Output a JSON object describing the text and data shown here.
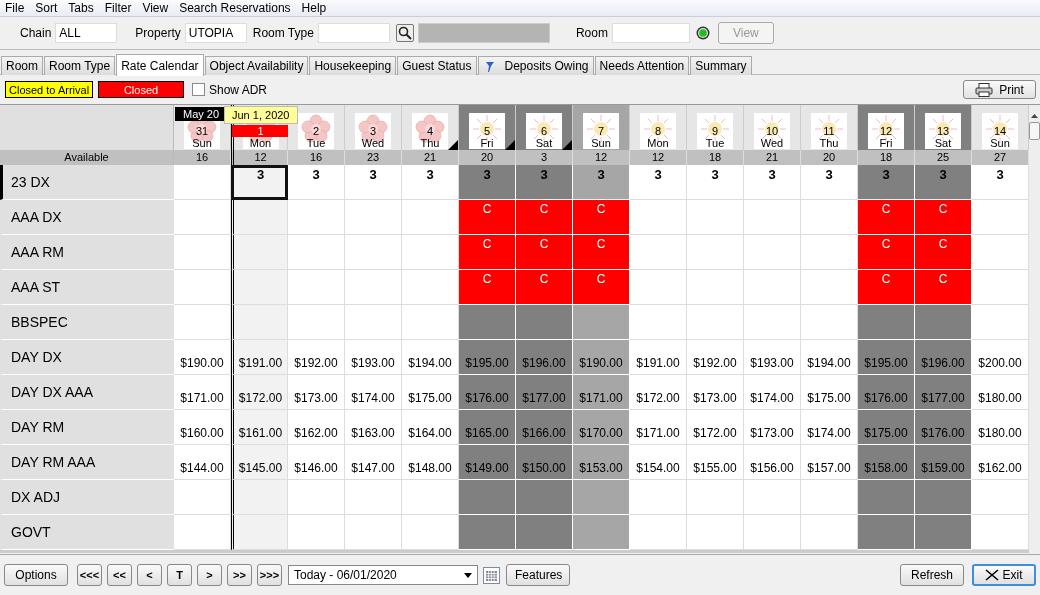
{
  "menu": [
    "File",
    "Sort",
    "Tabs",
    "Filter",
    "View",
    "Search Reservations",
    "Help"
  ],
  "toolbar": {
    "chain_label": "Chain",
    "chain": "ALL",
    "property_label": "Property",
    "property": "UTOPIA",
    "room_type_label": "Room Type",
    "room_label": "Room",
    "view_button": "View",
    "view_disabled": true
  },
  "tabs": [
    {
      "label": "Room",
      "selected": false,
      "kind": "plain"
    },
    {
      "label": "Room Type",
      "selected": false,
      "kind": "plain"
    },
    {
      "label": "Rate Calendar",
      "selected": true,
      "kind": "plain"
    },
    {
      "label": "Object Availability",
      "selected": false,
      "kind": "plain"
    },
    {
      "label": "Housekeeping",
      "selected": false,
      "kind": "plain"
    },
    {
      "label": "Guest Status",
      "selected": false,
      "kind": "plain"
    },
    {
      "label": "Deposits Owing",
      "selected": false,
      "kind": "flag"
    },
    {
      "label": "Needs Attention",
      "selected": false,
      "kind": "plain"
    },
    {
      "label": "Summary",
      "selected": false,
      "kind": "plain"
    }
  ],
  "legend": [
    {
      "label": "Closed to Arrival",
      "color": "#ffff00"
    },
    {
      "label": "Closed",
      "color": "#ff0000"
    }
  ],
  "show_adr": {
    "label": "Show ADR",
    "checked": false
  },
  "print_button": "Print",
  "grid": {
    "month": "May 20",
    "tooltip": "Jun 1, 2020",
    "available_label": "Available",
    "days": [
      {
        "day": "31",
        "weekday": "Sun",
        "available": "16",
        "kind": "flower",
        "weekend": false,
        "shaded": false,
        "today": false,
        "flag": false
      },
      {
        "day": "1",
        "weekday": "Mon",
        "available": "12",
        "kind": "flower",
        "weekend": false,
        "shaded": false,
        "today": true,
        "flag": false
      },
      {
        "day": "2",
        "weekday": "Tue",
        "available": "16",
        "kind": "flower",
        "weekend": false,
        "shaded": false,
        "today": false,
        "flag": false
      },
      {
        "day": "3",
        "weekday": "Wed",
        "available": "23",
        "kind": "flower",
        "weekend": false,
        "shaded": false,
        "today": false,
        "flag": false
      },
      {
        "day": "4",
        "weekday": "Thu",
        "available": "21",
        "kind": "flower",
        "weekend": false,
        "shaded": false,
        "today": false,
        "flag": true
      },
      {
        "day": "5",
        "weekday": "Fri",
        "available": "20",
        "kind": "sun",
        "weekend": true,
        "shaded": false,
        "today": false,
        "flag": true
      },
      {
        "day": "6",
        "weekday": "Sat",
        "available": "3",
        "kind": "sun",
        "weekend": true,
        "shaded": false,
        "today": false,
        "flag": true
      },
      {
        "day": "7",
        "weekday": "Sun",
        "available": "12",
        "kind": "sun",
        "weekend": false,
        "shaded": true,
        "today": false,
        "flag": false
      },
      {
        "day": "8",
        "weekday": "Mon",
        "available": "12",
        "kind": "sun",
        "weekend": false,
        "shaded": false,
        "today": false,
        "flag": false
      },
      {
        "day": "9",
        "weekday": "Tue",
        "available": "18",
        "kind": "sun",
        "weekend": false,
        "shaded": false,
        "today": false,
        "flag": false
      },
      {
        "day": "10",
        "weekday": "Wed",
        "available": "21",
        "kind": "sun",
        "weekend": false,
        "shaded": false,
        "today": false,
        "flag": false
      },
      {
        "day": "11",
        "weekday": "Thu",
        "available": "20",
        "kind": "sun",
        "weekend": false,
        "shaded": false,
        "today": false,
        "flag": false
      },
      {
        "day": "12",
        "weekday": "Fri",
        "available": "18",
        "kind": "sun",
        "weekend": true,
        "shaded": false,
        "today": false,
        "flag": false
      },
      {
        "day": "13",
        "weekday": "Sat",
        "available": "25",
        "kind": "sun",
        "weekend": true,
        "shaded": false,
        "today": false,
        "flag": false
      },
      {
        "day": "14",
        "weekday": "Sun",
        "available": "27",
        "kind": "sun",
        "weekend": false,
        "shaded": false,
        "today": false,
        "flag": false
      }
    ],
    "rows": [
      {
        "name": "23 DX",
        "selected": true,
        "kind": "count",
        "cells": [
          null,
          "3",
          "3",
          "3",
          "3",
          "3",
          "3",
          "3",
          "3",
          "3",
          "3",
          "3",
          "3",
          "3",
          "3"
        ],
        "closed": [
          false,
          false,
          false,
          false,
          false,
          false,
          false,
          false,
          false,
          false,
          false,
          false,
          false,
          false,
          false
        ]
      },
      {
        "name": "AAA DX",
        "selected": false,
        "kind": "status",
        "cells": [
          null,
          null,
          null,
          null,
          null,
          "C",
          "C",
          "C",
          null,
          null,
          null,
          null,
          "C",
          "C",
          null
        ],
        "closed": [
          false,
          false,
          false,
          false,
          false,
          true,
          true,
          true,
          false,
          false,
          false,
          false,
          true,
          true,
          false
        ]
      },
      {
        "name": "AAA RM",
        "selected": false,
        "kind": "status",
        "cells": [
          null,
          null,
          null,
          null,
          null,
          "C",
          "C",
          "C",
          null,
          null,
          null,
          null,
          "C",
          "C",
          null
        ],
        "closed": [
          false,
          false,
          false,
          false,
          false,
          true,
          true,
          true,
          false,
          false,
          false,
          false,
          true,
          true,
          false
        ]
      },
      {
        "name": "AAA ST",
        "selected": false,
        "kind": "status",
        "cells": [
          null,
          null,
          null,
          null,
          null,
          "C",
          "C",
          "C",
          null,
          null,
          null,
          null,
          "C",
          "C",
          null
        ],
        "closed": [
          false,
          false,
          false,
          false,
          false,
          true,
          true,
          true,
          false,
          false,
          false,
          false,
          true,
          true,
          false
        ]
      },
      {
        "name": "BBSPEC",
        "selected": false,
        "kind": "status",
        "cells": [
          null,
          null,
          null,
          null,
          null,
          null,
          null,
          null,
          null,
          null,
          null,
          null,
          null,
          null,
          null
        ],
        "closed": [
          false,
          false,
          false,
          false,
          false,
          false,
          false,
          false,
          false,
          false,
          false,
          false,
          false,
          false,
          false
        ]
      },
      {
        "name": "DAY DX",
        "selected": false,
        "kind": "rate",
        "cells": [
          "$190.00",
          "$191.00",
          "$192.00",
          "$193.00",
          "$194.00",
          "$195.00",
          "$196.00",
          "$190.00",
          "$191.00",
          "$192.00",
          "$193.00",
          "$194.00",
          "$195.00",
          "$196.00",
          "$200.00"
        ],
        "closed": [
          false,
          false,
          false,
          false,
          false,
          false,
          false,
          false,
          false,
          false,
          false,
          false,
          false,
          false,
          false
        ]
      },
      {
        "name": "DAY DX AAA",
        "selected": false,
        "kind": "rate",
        "cells": [
          "$171.00",
          "$172.00",
          "$173.00",
          "$174.00",
          "$175.00",
          "$176.00",
          "$177.00",
          "$171.00",
          "$172.00",
          "$173.00",
          "$174.00",
          "$175.00",
          "$176.00",
          "$177.00",
          "$180.00"
        ],
        "closed": [
          false,
          false,
          false,
          false,
          false,
          false,
          false,
          false,
          false,
          false,
          false,
          false,
          false,
          false,
          false
        ]
      },
      {
        "name": "DAY RM",
        "selected": false,
        "kind": "rate",
        "cells": [
          "$160.00",
          "$161.00",
          "$162.00",
          "$163.00",
          "$164.00",
          "$165.00",
          "$166.00",
          "$170.00",
          "$171.00",
          "$172.00",
          "$173.00",
          "$174.00",
          "$175.00",
          "$176.00",
          "$180.00"
        ],
        "closed": [
          false,
          false,
          false,
          false,
          false,
          false,
          false,
          false,
          false,
          false,
          false,
          false,
          false,
          false,
          false
        ]
      },
      {
        "name": "DAY RM AAA",
        "selected": false,
        "kind": "rate",
        "cells": [
          "$144.00",
          "$145.00",
          "$146.00",
          "$147.00",
          "$148.00",
          "$149.00",
          "$150.00",
          "$153.00",
          "$154.00",
          "$155.00",
          "$156.00",
          "$157.00",
          "$158.00",
          "$159.00",
          "$162.00"
        ],
        "closed": [
          false,
          false,
          false,
          false,
          false,
          false,
          false,
          false,
          false,
          false,
          false,
          false,
          false,
          false,
          false
        ]
      },
      {
        "name": "DX ADJ",
        "selected": false,
        "kind": "status",
        "cells": [
          null,
          null,
          null,
          null,
          null,
          null,
          null,
          null,
          null,
          null,
          null,
          null,
          null,
          null,
          null
        ],
        "closed": [
          false,
          false,
          false,
          false,
          false,
          false,
          false,
          false,
          false,
          false,
          false,
          false,
          false,
          false,
          false
        ]
      },
      {
        "name": "GOVT",
        "selected": false,
        "kind": "status",
        "cells": [
          null,
          null,
          null,
          null,
          null,
          null,
          null,
          null,
          null,
          null,
          null,
          null,
          null,
          null,
          null
        ],
        "closed": [
          false,
          false,
          false,
          false,
          false,
          false,
          false,
          false,
          false,
          false,
          false,
          false,
          false,
          false,
          false
        ]
      }
    ]
  },
  "bottom": {
    "options": "Options",
    "nav": [
      "<<<",
      "<<",
      "<",
      "T",
      ">",
      ">>",
      ">>>"
    ],
    "date_select": "Today - 06/01/2020",
    "features": "Features",
    "refresh": "Refresh",
    "exit": "Exit"
  }
}
